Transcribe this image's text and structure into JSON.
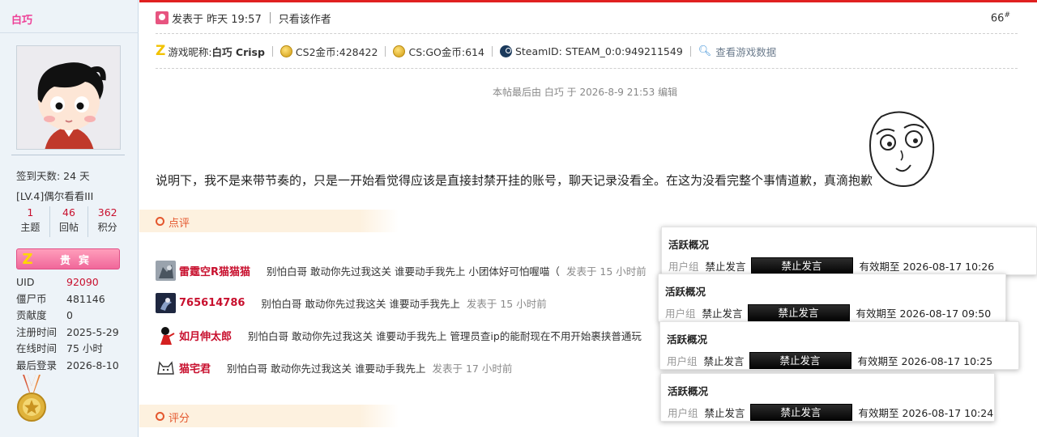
{
  "sidebar": {
    "username": "白巧",
    "checkin": "签到天数: 24 天",
    "level": "[LV.4]偶尔看看III",
    "stats": [
      {
        "value": "1",
        "label": "主题"
      },
      {
        "value": "46",
        "label": "回帖"
      },
      {
        "value": "362",
        "label": "积分"
      }
    ],
    "badge_text": "贵宾",
    "info": [
      {
        "key": "UID",
        "value": "92090"
      },
      {
        "key": "僵尸币",
        "value": "481146"
      },
      {
        "key": "贡献度",
        "value": "0"
      },
      {
        "key": "注册时间",
        "value": "2025-5-29"
      },
      {
        "key": "在线时间",
        "value": "75 小时"
      },
      {
        "key": "最后登录",
        "value": "2026-8-10"
      }
    ]
  },
  "post": {
    "posted_at": "发表于 昨天 19:57",
    "only_author": "只看该作者",
    "floor": "66",
    "floor_sup": "#",
    "game": {
      "nickname_label": "游戏昵称:",
      "nickname": "白巧 Crisp",
      "cs2": "CS2金币:428422",
      "csgo": "CS:GO金币:614",
      "steamid": "SteamID: STEAM_0:0:949211549",
      "view_data": "查看游戏数据"
    },
    "edited": "本帖最后由 白巧 于 2026-8-9 21:53 编辑",
    "body": "说明下，我不是来带节奏的，只是一开始看觉得应该是直接封禁开挂的账号，聊天记录没看全。在这为没看完整个事情道歉，真滴抱歉"
  },
  "comments_section": {
    "title": "点评",
    "items": [
      {
        "name": "雷霆空R猫猫猫",
        "text": "别怕白哥 敢动你先过我这关 谁要动手我先上 小团体好可怕喔喵（",
        "time": "发表于 15 小时前"
      },
      {
        "name": "765614786",
        "text": "别怕白哥 敢动你先过我这关 谁要动手我先上",
        "time": "发表于 15 小时前"
      },
      {
        "name": "如月伸太郎",
        "text": "别怕白哥 敢动你先过我这关 谁要动手我先上 管理员查ip的能耐现在不用开始裹挟普通玩",
        "time": ""
      },
      {
        "name": "猫宅君",
        "text": "别怕白哥 敢动你先过我这关 谁要动手我先上",
        "time": "发表于 17 小时前"
      }
    ]
  },
  "rating_section": {
    "title": "评分"
  },
  "popups": [
    {
      "title": "活跃概况",
      "group_label": "用户组",
      "status": "禁止发言",
      "button": "禁止发言",
      "expiry": "有效期至 2026-08-17 10:26"
    },
    {
      "title": "活跃概况",
      "group_label": "用户组",
      "status": "禁止发言",
      "button": "禁止发言",
      "expiry": "有效期至 2026-08-17 09:50"
    },
    {
      "title": "活跃概况",
      "group_label": "用户组",
      "status": "禁止发言",
      "button": "禁止发言",
      "expiry": "有效期至 2026-08-17 10:25"
    },
    {
      "title": "活跃概况",
      "group_label": "用户组",
      "status": "禁止发言",
      "button": "禁止发言",
      "expiry": "有效期至 2026-08-17 10:24"
    }
  ]
}
